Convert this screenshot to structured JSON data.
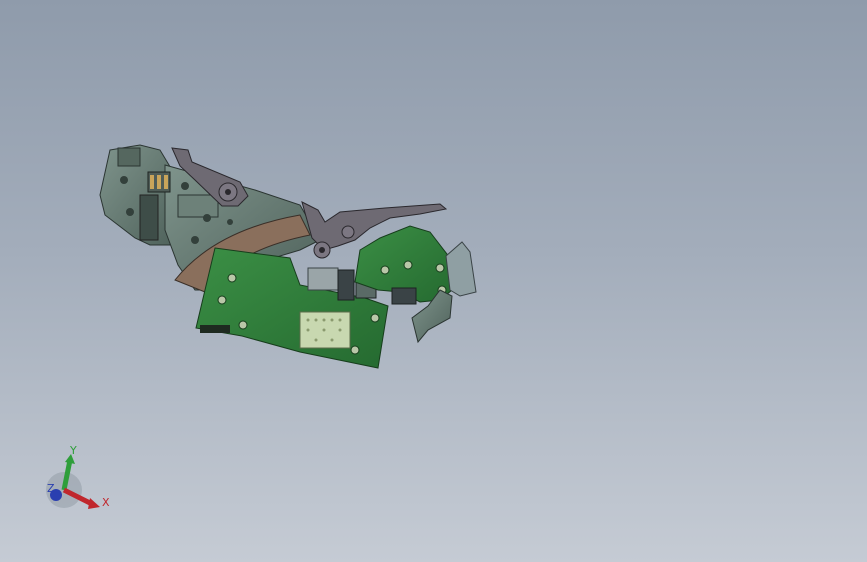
{
  "viewport": {
    "background_top": "#8f9bab",
    "background_bottom": "#c5cbd4"
  },
  "model": {
    "pcb_color": "#2f7d3a",
    "body_color": "#6b8078",
    "lever_color": "#6e6a73"
  },
  "triad": {
    "x_label": "X",
    "y_label": "Y",
    "z_label": "Z",
    "x_color": "#c0272d",
    "y_color": "#2e9e3a",
    "z_color": "#2a3fb0"
  }
}
